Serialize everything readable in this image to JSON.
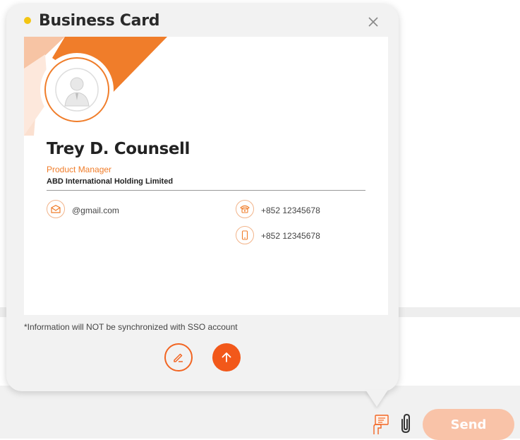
{
  "popup": {
    "title": "Business Card",
    "status_color": "#f3c512",
    "close_icon": "close-icon"
  },
  "card": {
    "name": "Trey D. Counsell",
    "job_title": "Product Manager",
    "company": "ABD International Holding Limited",
    "email": "@gmail.com",
    "office_phone": "+852 12345678",
    "mobile_phone": "+852 12345678",
    "accent_color": "#f07d2a"
  },
  "note": "*Information will NOT be synchronized with SSO account",
  "actions": {
    "edit_icon": "edit-icon",
    "send_card_icon": "arrow-up-icon"
  },
  "composer": {
    "send_label": "Send",
    "business_card_icon": "business-card-icon",
    "attach_icon": "paperclip-icon"
  }
}
